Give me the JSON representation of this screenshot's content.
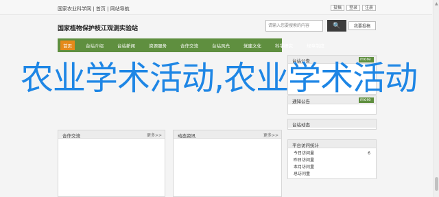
{
  "topbar": {
    "nav": "国家农业科学网 | 首页 | 网站导航",
    "actions": [
      "投稿",
      "登录",
      "注册"
    ]
  },
  "header": {
    "title": "国家植物保护枝江观测实验站",
    "search_placeholder": "请输入您要搜索的内容",
    "search_button": "🔍",
    "contribute": "我要投稿"
  },
  "nav": {
    "items": [
      "首页",
      "台站介绍",
      "台站新闻",
      "资源服务",
      "合作交流",
      "台站风光",
      "党建文化",
      "科学研究",
      "规章制度"
    ]
  },
  "banner": {
    "text": "农业学术活动,农业学术活动"
  },
  "panels": {
    "announcement": {
      "title": "台站公告",
      "more": "more"
    },
    "notice": {
      "title": "通知公告",
      "more": "more"
    },
    "dynamics": {
      "title": "台站动态"
    },
    "stats": {
      "title": "平台访问统计"
    },
    "cooperation": {
      "title": "合作交流",
      "more": "更多>>"
    },
    "activity": {
      "title": "动态资讯",
      "more": "更多>>"
    }
  },
  "stats_rows": [
    {
      "label": "今日访问量",
      "value": "6"
    },
    {
      "label": "昨日访问量",
      "value": ""
    },
    {
      "label": "本月访问量",
      "value": ""
    },
    {
      "label": "总访问量",
      "value": ""
    }
  ]
}
